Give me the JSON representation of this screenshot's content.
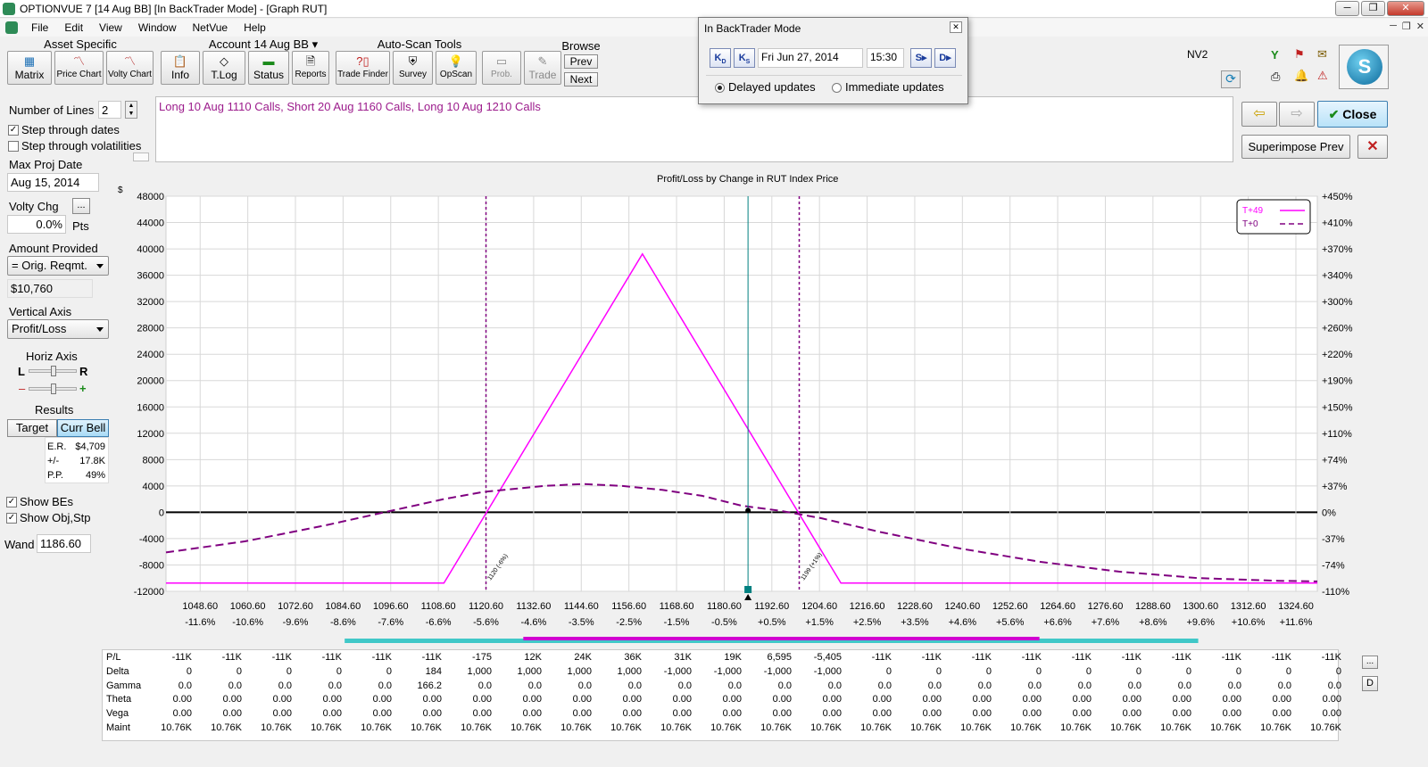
{
  "window": {
    "title": "OPTIONVUE 7    [14 Aug BB]    [In BackTrader Mode] - [Graph RUT]",
    "controls": [
      "─",
      "❐",
      "✕"
    ]
  },
  "menu": [
    "File",
    "Edit",
    "View",
    "Window",
    "NetVue",
    "Help"
  ],
  "toolbar": {
    "asset_specific": "Asset Specific",
    "account": "Account 14 Aug BB",
    "auto_scan": "Auto-Scan Tools",
    "browse": "Browse",
    "buttons": {
      "matrix": "Matrix",
      "price_chart": "Price Chart",
      "volty_chart": "Volty Chart",
      "info": "Info",
      "tlog": "T.Log",
      "status": "Status",
      "reports": "Reports",
      "trade_finder": "Trade Finder",
      "survey": "Survey",
      "opscan": "OpScan",
      "prob": "Prob.",
      "trade": "Trade",
      "prev": "Prev",
      "next": "Next"
    },
    "nv2": "NV2",
    "logo_letter": "S"
  },
  "popup": {
    "title": "In BackTrader Mode",
    "date": "Fri Jun 27, 2014",
    "time": "15:30",
    "delayed": "Delayed updates",
    "immediate": "Immediate updates",
    "selected": "delayed"
  },
  "left": {
    "num_lines_label": "Number of Lines",
    "num_lines": "2",
    "step_dates": "Step through dates",
    "step_volatilities": "Step through volatilities",
    "max_proj_date_label": "Max Proj Date",
    "max_proj_date": "Aug 15, 2014",
    "volty_chg_label": "Volty Chg",
    "volty_chg": "0.0%",
    "pts": "Pts",
    "amount_provided_label": "Amount Provided",
    "amount_provided": "= Orig. Reqmt.",
    "amount_value": "$10,760",
    "vertical_axis_label": "Vertical Axis",
    "vertical_axis": "Profit/Loss",
    "horiz_axis_label": "Horiz Axis",
    "L": "L",
    "R": "R",
    "minus": "–",
    "plus": "+",
    "results_label": "Results",
    "target": "Target",
    "curr_bell": "Curr Bell",
    "er_label": "E.R.",
    "er": "$4,709",
    "pm_label": "+/-",
    "pm": "17.8K",
    "pp_label": "P.P.",
    "pp": "49%",
    "show_bes": "Show BEs",
    "show_obj": "Show Obj,Stp",
    "wand_label": "Wand",
    "wand": "1186.60"
  },
  "description": "Long 10 Aug 1110 Calls, Short 20 Aug 1160 Calls, Long 10 Aug 1210 Calls",
  "right_buttons": {
    "close": "Close",
    "superimpose": "Superimpose Prev"
  },
  "colors": {
    "t49": "#ff00ff",
    "t0": "#800080",
    "be_line": "#800080",
    "wand_line": "#008080",
    "bell": "#40c8c8",
    "bell_inner": "#d000d0"
  },
  "chart_data": {
    "type": "line",
    "title": "Profit/Loss by Change in RUT Index Price",
    "ylabel": "$",
    "ylim": [
      -12000,
      48000
    ],
    "yticks": [
      48000,
      44000,
      40000,
      36000,
      32000,
      28000,
      24000,
      20000,
      16000,
      12000,
      8000,
      4000,
      0,
      -4000,
      -8000,
      -12000
    ],
    "yticks_right": [
      "+450%",
      "+410%",
      "+370%",
      "+340%",
      "+300%",
      "+260%",
      "+220%",
      "+190%",
      "+150%",
      "+110%",
      "+74%",
      "+37%",
      "0%",
      "-37%",
      "-74%",
      "-110%"
    ],
    "xlim": [
      1040,
      1330
    ],
    "xticks": [
      1048.6,
      1060.6,
      1072.6,
      1084.6,
      1096.6,
      1108.6,
      1120.6,
      1132.6,
      1144.6,
      1156.6,
      1168.6,
      1180.6,
      1192.6,
      1204.6,
      1216.6,
      1228.6,
      1240.6,
      1252.6,
      1264.6,
      1276.6,
      1288.6,
      1300.6,
      1312.6,
      1324.6
    ],
    "xtick_labels": [
      "1048.60",
      "1060.60",
      "1072.60",
      "1084.60",
      "1096.60",
      "1108.60",
      "1120.60",
      "1132.60",
      "1144.60",
      "1156.60",
      "1168.60",
      "1180.60",
      "1192.60",
      "1204.60",
      "1216.60",
      "1228.60",
      "1240.60",
      "1252.60",
      "1264.60",
      "1276.60",
      "1288.60",
      "1300.60",
      "1312.60",
      "1324.60"
    ],
    "xtick_pct": [
      "-11.6%",
      "-10.6%",
      "-9.6%",
      "-8.6%",
      "-7.6%",
      "-6.6%",
      "-5.6%",
      "-4.6%",
      "-3.5%",
      "-2.5%",
      "-1.5%",
      "-0.5%",
      "+0.5%",
      "+1.5%",
      "+2.5%",
      "+3.5%",
      "+4.6%",
      "+5.6%",
      "+6.6%",
      "+7.6%",
      "+8.6%",
      "+9.6%",
      "+10.6%",
      "+11.6%"
    ],
    "series": [
      {
        "name": "T+49",
        "style": "solid",
        "x": [
          1040,
          1110,
          1160,
          1210,
          1330
        ],
        "y": [
          -10760,
          -10760,
          39240,
          -10760,
          -10760
        ]
      },
      {
        "name": "T+0",
        "style": "dashed",
        "x": [
          1040,
          1060,
          1080,
          1095,
          1110,
          1120,
          1135,
          1145,
          1155,
          1165,
          1175,
          1185,
          1195,
          1205,
          1220,
          1240,
          1260,
          1280,
          1300,
          1320,
          1330
        ],
        "y": [
          -6100,
          -4400,
          -2000,
          0,
          2000,
          3100,
          4000,
          4300,
          4000,
          3400,
          2500,
          1000,
          200,
          -900,
          -3000,
          -5500,
          -7500,
          -9000,
          -10000,
          -10400,
          -10500
        ]
      }
    ],
    "breakevens": [
      1120.6,
      1199.5
    ],
    "breakeven_labels": [
      "1120 (-6%)",
      "1199 (+1%)"
    ],
    "wand": 1186.6,
    "grid": true,
    "legend": "top-right",
    "bell_range": [
      1085,
      1300
    ],
    "bell_inner_range": [
      1130,
      1260
    ]
  },
  "table": {
    "rows": [
      {
        "label": "P/L",
        "values": [
          "-11K",
          "-11K",
          "-11K",
          "-11K",
          "-11K",
          "-11K",
          "-175",
          "12K",
          "24K",
          "36K",
          "31K",
          "19K",
          "6,595",
          "-5,405",
          "-11K",
          "-11K",
          "-11K",
          "-11K",
          "-11K",
          "-11K",
          "-11K",
          "-11K",
          "-11K",
          "-11K"
        ]
      },
      {
        "label": "Delta",
        "values": [
          "0",
          "0",
          "0",
          "0",
          "0",
          "184",
          "1,000",
          "1,000",
          "1,000",
          "1,000",
          "-1,000",
          "-1,000",
          "-1,000",
          "-1,000",
          "0",
          "0",
          "0",
          "0",
          "0",
          "0",
          "0",
          "0",
          "0",
          "0"
        ]
      },
      {
        "label": "Gamma",
        "values": [
          "0.0",
          "0.0",
          "0.0",
          "0.0",
          "0.0",
          "166.2",
          "0.0",
          "0.0",
          "0.0",
          "0.0",
          "0.0",
          "0.0",
          "0.0",
          "0.0",
          "0.0",
          "0.0",
          "0.0",
          "0.0",
          "0.0",
          "0.0",
          "0.0",
          "0.0",
          "0.0",
          "0.0"
        ]
      },
      {
        "label": "Theta",
        "values": [
          "0.00",
          "0.00",
          "0.00",
          "0.00",
          "0.00",
          "0.00",
          "0.00",
          "0.00",
          "0.00",
          "0.00",
          "0.00",
          "0.00",
          "0.00",
          "0.00",
          "0.00",
          "0.00",
          "0.00",
          "0.00",
          "0.00",
          "0.00",
          "0.00",
          "0.00",
          "0.00",
          "0.00"
        ]
      },
      {
        "label": "Vega",
        "values": [
          "0.00",
          "0.00",
          "0.00",
          "0.00",
          "0.00",
          "0.00",
          "0.00",
          "0.00",
          "0.00",
          "0.00",
          "0.00",
          "0.00",
          "0.00",
          "0.00",
          "0.00",
          "0.00",
          "0.00",
          "0.00",
          "0.00",
          "0.00",
          "0.00",
          "0.00",
          "0.00",
          "0.00"
        ]
      },
      {
        "label": "Maint",
        "values": [
          "10.76K",
          "10.76K",
          "10.76K",
          "10.76K",
          "10.76K",
          "10.76K",
          "10.76K",
          "10.76K",
          "10.76K",
          "10.76K",
          "10.76K",
          "10.76K",
          "10.76K",
          "10.76K",
          "10.76K",
          "10.76K",
          "10.76K",
          "10.76K",
          "10.76K",
          "10.76K",
          "10.76K",
          "10.76K",
          "10.76K",
          "10.76K"
        ]
      }
    ],
    "side_buttons": [
      "...",
      "D"
    ]
  }
}
